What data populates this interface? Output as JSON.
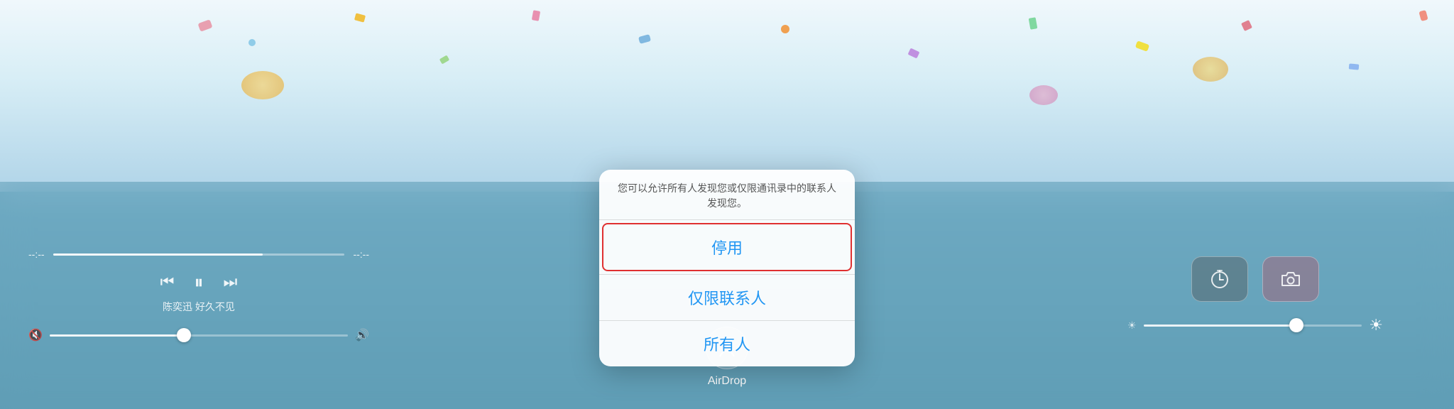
{
  "background": {
    "topColor": "#e0f0f8",
    "bottomColor": "#5a9ab5"
  },
  "media": {
    "timeStart": "--:--",
    "timeEnd": "--:--",
    "artist": "陈奕迅",
    "song": "好久不见",
    "progressPercent": 72,
    "volumePercent": 45,
    "prevBtn": "⏮",
    "playBtn": "⏸",
    "nextBtn": "⏭"
  },
  "airdrop": {
    "label": "AirDrop",
    "icon": "airdrop-icon"
  },
  "rightPanel": {
    "timerLabel": "timer",
    "cameraLabel": "camera"
  },
  "popup": {
    "description": "您可以允许所有人发现您或仅限通讯录中的联系人发现您。",
    "option1": {
      "label": "停用",
      "selected": true
    },
    "option2": {
      "label": "仅限联系人",
      "selected": false
    },
    "option3": {
      "label": "所有人",
      "selected": false
    }
  }
}
